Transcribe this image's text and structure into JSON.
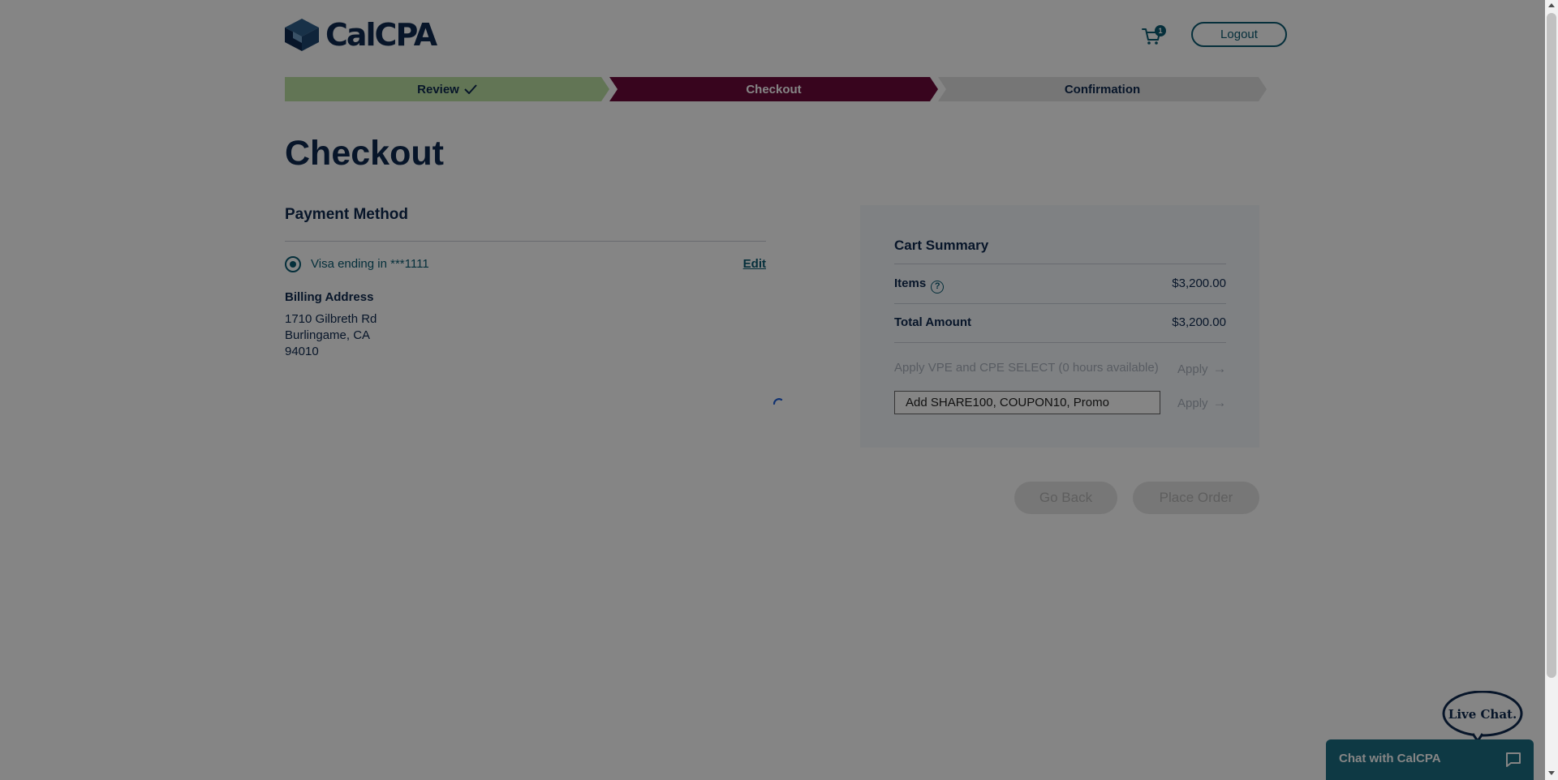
{
  "header": {
    "logo_text": "CalCPA",
    "cart_count": "1",
    "logout_label": "Logout"
  },
  "steps": {
    "review": "Review",
    "checkout": "Checkout",
    "confirmation": "Confirmation"
  },
  "page_title": "Checkout",
  "payment": {
    "section_title": "Payment Method",
    "card_label": "Visa ending in ***1111",
    "edit_label": "Edit",
    "billing_title": "Billing Address",
    "address_line1": "1710 Gilbreth Rd",
    "address_line2": "Burlingame, CA",
    "address_line3": "94010"
  },
  "summary": {
    "title": "Cart Summary",
    "items_label": "Items",
    "items_value": "$3,200.00",
    "total_label": "Total Amount",
    "total_value": "$3,200.00",
    "vpe_text": "Apply VPE and CPE SELECT (0 hours available)",
    "apply_label": "Apply",
    "promo_placeholder": "Add SHARE100, COUPON10, Promo"
  },
  "actions": {
    "go_back": "Go Back",
    "place_order": "Place Order"
  },
  "chat": {
    "bubble_text": "Live Chat.",
    "bar_label": "Chat with CalCPA"
  },
  "colors": {
    "navy": "#0f2a4f",
    "teal": "#0a5b72",
    "review_green": "#bce0a4",
    "checkout_maroon": "#6b0a3b",
    "confirm_gray": "#e3e3e3"
  }
}
